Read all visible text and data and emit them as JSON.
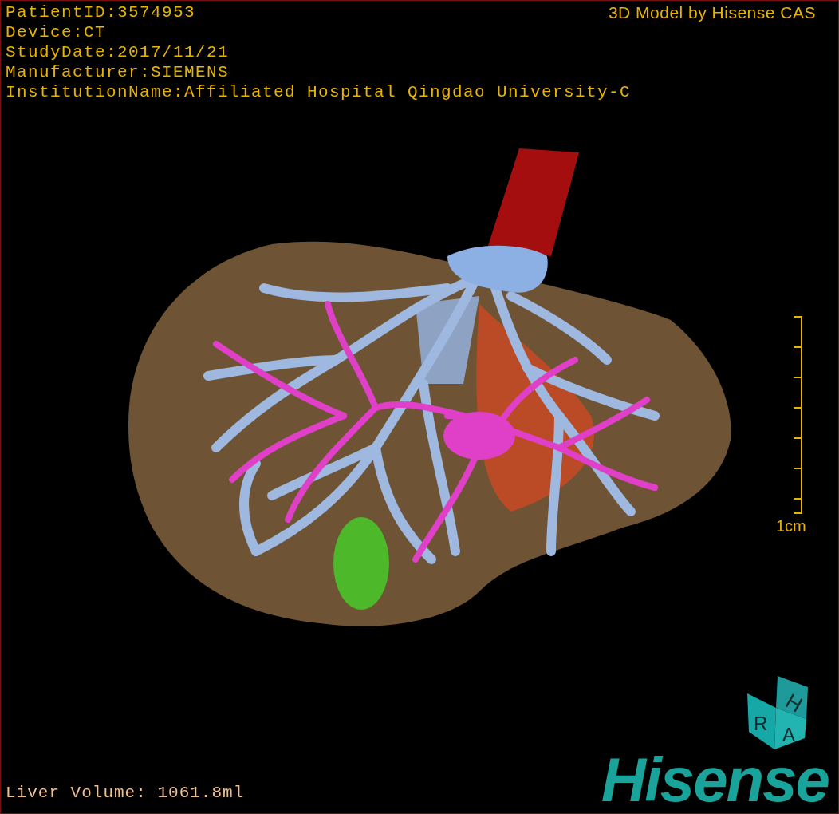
{
  "info_lines": [
    "PatientID:3574953",
    "Device:CT",
    "StudyDate:2017/11/21",
    "Manufacturer:SIEMENS",
    "InstitutionName:Affiliated Hospital Qingdao University-C"
  ],
  "title": "3D Model by Hisense CAS",
  "scale_bar": {
    "label": "1cm"
  },
  "liver_volume": "Liver Volume: 1061.8ml",
  "orientation_cube": {
    "faces": [
      "H",
      "R",
      "A"
    ]
  },
  "logo": "Hisense"
}
